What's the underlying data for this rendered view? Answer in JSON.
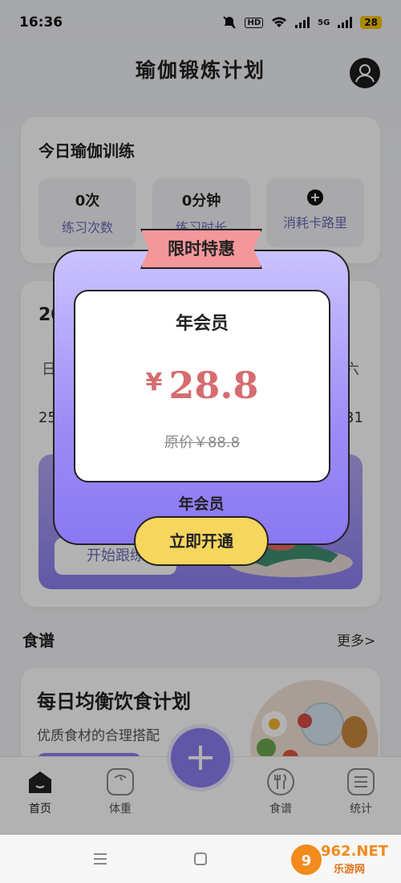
{
  "status_bar": {
    "time": "16:36",
    "hd_label": "HD",
    "net_5g": "5G",
    "battery": "28"
  },
  "header": {
    "title": "瑜伽锻炼计划"
  },
  "today": {
    "title": "今日瑜伽训练",
    "stats": [
      {
        "value": "0次",
        "label": "练习次数"
      },
      {
        "value": "0分钟",
        "label": "练习时长"
      },
      {
        "value": "+",
        "label": "消耗卡路里"
      }
    ]
  },
  "calendar": {
    "title_partial": "20",
    "weekday_first": "日",
    "weekday_last": "六",
    "date_first": "25",
    "date_last": "31",
    "start_button": "开始跟练"
  },
  "recipes": {
    "title": "食谱",
    "more": "更多>",
    "card_title": "每日均衡饮食计划",
    "card_sub": "优质食材的合理搭配"
  },
  "bottom_nav": {
    "items": [
      {
        "label": "首页",
        "icon": "home-icon"
      },
      {
        "label": "体重",
        "icon": "scale-icon"
      },
      {
        "label": "食谱",
        "icon": "utensils-icon"
      },
      {
        "label": "统计",
        "icon": "list-icon"
      }
    ],
    "fab_symbol": "+"
  },
  "promo": {
    "ribbon": "限时特惠",
    "plan": "年会员",
    "currency": "¥",
    "price": "28.8",
    "original": "原价￥88.8",
    "label": "年会员",
    "button": "立即开通"
  },
  "watermark": {
    "text": "962.NET",
    "sub": "乐游网"
  },
  "colors": {
    "accent": "#8b7df0",
    "price": "#d66c70",
    "ribbon": "#f4979a",
    "button": "#f7d65e"
  }
}
